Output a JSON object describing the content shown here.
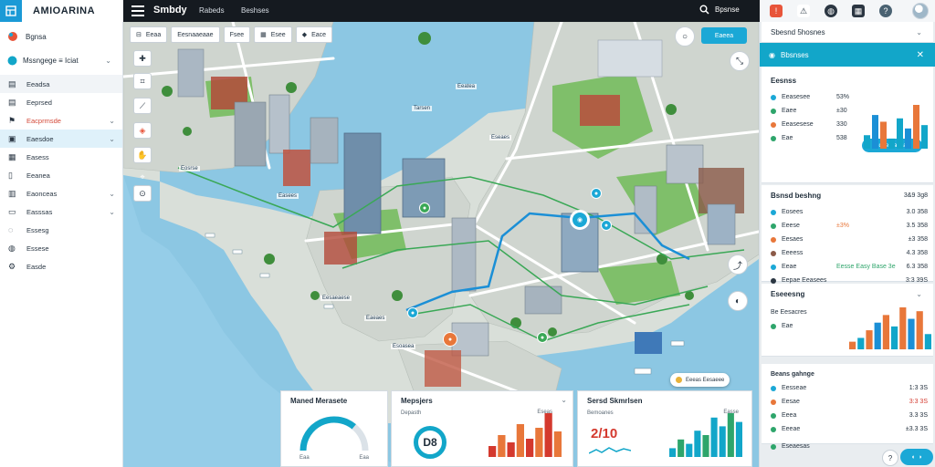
{
  "app": {
    "name": "AMIOARINA"
  },
  "topbar": {
    "title": "Smbdy",
    "links": [
      "Rabeds",
      "Beshses"
    ],
    "search_label": "Bpsnse"
  },
  "sidebar": {
    "header": "Bgnsa",
    "selector": "Mssngege ≡ Iciat",
    "items": [
      {
        "label": "Eeadsa",
        "icon": "layers-icon",
        "chevron": false,
        "state": "hl"
      },
      {
        "label": "Eeprsed",
        "icon": "layers-icon",
        "chevron": false,
        "state": ""
      },
      {
        "label": "Eacprmsde",
        "icon": "alert-icon",
        "chevron": true,
        "state": "",
        "color": "#d44a3a"
      },
      {
        "label": "Eaesdoe",
        "icon": "map-icon",
        "chevron": true,
        "state": "active"
      },
      {
        "label": "Easess",
        "icon": "grid-icon",
        "chevron": false,
        "state": ""
      },
      {
        "label": "Eeanea",
        "icon": "document-icon",
        "chevron": false,
        "state": ""
      },
      {
        "label": "Eaonceas",
        "icon": "calendar-icon",
        "chevron": true,
        "state": ""
      },
      {
        "label": "Easssas",
        "icon": "folder-icon",
        "chevron": true,
        "state": ""
      },
      {
        "label": "Essesg",
        "icon": "info-icon",
        "chevron": false,
        "state": ""
      },
      {
        "label": "Essese",
        "icon": "settings-icon",
        "chevron": false,
        "state": ""
      },
      {
        "label": "Easde",
        "icon": "gear-icon",
        "chevron": false,
        "state": ""
      }
    ]
  },
  "map": {
    "filters": [
      "Eeaa",
      "Eesnaaeaae",
      "Fsee",
      "Esee",
      "Eace"
    ],
    "primary_button": "Eaeea",
    "labels": [
      {
        "text": "Eeatea"
      },
      {
        "text": "Tarsen"
      },
      {
        "text": "Eseaes"
      },
      {
        "text": "Eosrse"
      },
      {
        "text": "Easees"
      },
      {
        "text": "Eesaeaese"
      },
      {
        "text": "Eaeaes"
      },
      {
        "text": "Esoasea"
      }
    ],
    "legend_chip": "Eeeas Eesaeee"
  },
  "bottom_cards": [
    {
      "title": "Maned Merasete",
      "gauge_value": 0.72,
      "gauge_min": "Eaa",
      "gauge_max": "Eaa"
    },
    {
      "title": "Mepsjers",
      "sub": "Depasth",
      "big_value": "D8",
      "bars": [
        3,
        6,
        4,
        9,
        5,
        8,
        12,
        7
      ],
      "axis": "Eseas"
    },
    {
      "title": "Sersd Skmrlsen",
      "sub": "Bemoanes",
      "big_value": "2/10",
      "bars": [
        2,
        4,
        3,
        6,
        5,
        9,
        7,
        10,
        8
      ],
      "axis": "Easse"
    }
  ],
  "right_panel": {
    "header": "Sbesnd 5hosnes",
    "active_bar": "Bbsnses",
    "stats_title": "Eesnss",
    "stats_button": "Rdaeo ahsas",
    "stats_rows": [
      {
        "label": "Eeasesee",
        "value": "53%",
        "color": "#1ba8d6"
      },
      {
        "label": "Eaee",
        "value": "±30",
        "color": "#2ea56b"
      },
      {
        "label": "Eeasesese",
        "value": "330",
        "color": "#e8773a"
      },
      {
        "label": "Eae",
        "value": "538",
        "color": "#2ea56b"
      }
    ],
    "stats_bars": [
      4,
      10,
      8,
      3,
      9,
      6,
      13,
      7
    ],
    "list_title": "Bsnsd beshng",
    "list_header_val": "3&9 3g8",
    "list_rows": [
      {
        "label": "Eosees",
        "value": "3.0 358",
        "mid": ""
      },
      {
        "label": "Eeese",
        "value": "3.5 358",
        "mid": "±3%"
      },
      {
        "label": "Eesaes",
        "value": "±3 358",
        "mid": ""
      },
      {
        "label": "Eeeess",
        "value": "4.3 358",
        "mid": ""
      },
      {
        "label": "Eeae",
        "value": "6.3 358",
        "mid": "Eesse Easy Base 3e"
      },
      {
        "label": "Eepae Eeasees",
        "value": "3:3 39S",
        "mid": ""
      }
    ],
    "chart_title": "Eseeesng",
    "chart_legend": "Be Eesacres",
    "chart_legend2": "Eae",
    "chart_bars": [
      2,
      3,
      5,
      7,
      9,
      6,
      11,
      8,
      10,
      4
    ],
    "bottom_title": "Beans gahnge",
    "bottom_rows": [
      {
        "label": "Eesseae",
        "value": "1:3 3S",
        "color": "#1ba8d6"
      },
      {
        "label": "Eesae",
        "value": "3:3 3S",
        "color": "#e8773a"
      },
      {
        "label": "Eeea",
        "value": "3.3 3S",
        "color": "#2ea56b"
      },
      {
        "label": "Eeeae",
        "value": "±3.3 3S",
        "color": "#2ea56b"
      }
    ],
    "footer_label": "Eseaesas"
  },
  "colors": {
    "accent": "#1ba8d6",
    "water": "#8cc7e3",
    "route": "#1b8fd6",
    "green": "#3aa856"
  }
}
